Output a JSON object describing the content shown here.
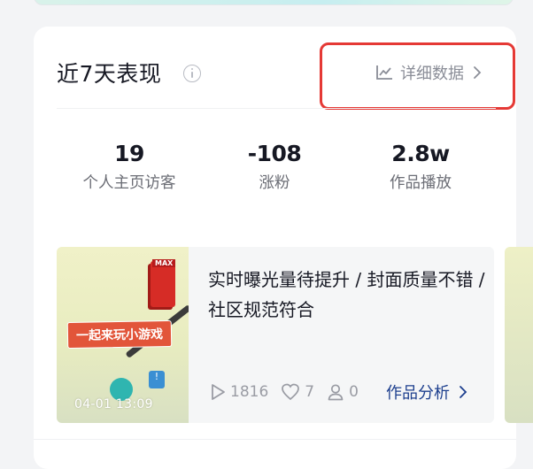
{
  "section": {
    "title": "近7天表现",
    "detail_label": "详细数据"
  },
  "metrics": [
    {
      "value": "19",
      "label": "个人主页访客"
    },
    {
      "value": "-108",
      "label": "涨粉"
    },
    {
      "value": "2.8w",
      "label": "作品播放"
    }
  ],
  "work": {
    "thumbnail_banner": "一起来玩小游戏",
    "thumbnail_tag": "MAX",
    "date": "04-01 13:09",
    "title": "实时曝光量待提升 / 封面质量不错 / 社区规范符合",
    "plays": "1816",
    "likes": "7",
    "profile_visits": "0",
    "analysis_label": "作品分析"
  },
  "colors": {
    "highlight": "#e53935",
    "link": "#1d3f8e",
    "muted": "#9a9ca4"
  },
  "icons": [
    "info-icon",
    "line-chart-icon",
    "chevron-right-icon",
    "play-icon",
    "heart-icon",
    "person-icon"
  ]
}
